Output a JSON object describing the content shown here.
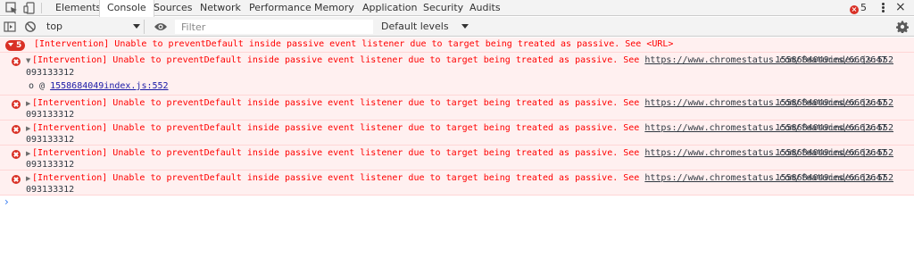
{
  "tabs": [
    "Elements",
    "Console",
    "Sources",
    "Network",
    "Performance",
    "Memory",
    "Application",
    "Security",
    "Audits"
  ],
  "active_tab": "Console",
  "error_count": "5",
  "toolbar": {
    "context": "top",
    "filter_placeholder": "Filter",
    "levels": "Default levels"
  },
  "group": {
    "count": "5",
    "text": "[Intervention] Unable to preventDefault inside passive event listener due to target being treated as passive. See <URL>"
  },
  "messages": [
    {
      "text": "[Intervention] Unable to preventDefault inside passive event listener due to target being treated as passive. See ",
      "url": "https://www.chromestatus.com/features/6662647",
      "url_cont": "093133312",
      "source": "1558684049index.js:552",
      "expanded": true,
      "stack_prefix": "o @ ",
      "stack_link": "1558684049index.js:552"
    },
    {
      "text": "[Intervention] Unable to preventDefault inside passive event listener due to target being treated as passive. See ",
      "url": "https://www.chromestatus.com/features/6662647",
      "url_cont": "093133312",
      "source": "1558684049index.js:552"
    },
    {
      "text": "[Intervention] Unable to preventDefault inside passive event listener due to target being treated as passive. See ",
      "url": "https://www.chromestatus.com/features/6662647",
      "url_cont": "093133312",
      "source": "1558684049index.js:552"
    },
    {
      "text": "[Intervention] Unable to preventDefault inside passive event listener due to target being treated as passive. See ",
      "url": "https://www.chromestatus.com/features/6662647",
      "url_cont": "093133312",
      "source": "1558684049index.js:552"
    },
    {
      "text": "[Intervention] Unable to preventDefault inside passive event listener due to target being treated as passive. See ",
      "url": "https://www.chromestatus.com/features/6662647",
      "url_cont": "093133312",
      "source": "1558684049index.js:552"
    }
  ],
  "prompt": "›",
  "colors": {
    "error_red": "#ff0000",
    "error_bg": "#fff0f0",
    "badge_red": "#d93025",
    "link_blue": "#1a1aa6",
    "prompt_blue": "#367cf1"
  }
}
